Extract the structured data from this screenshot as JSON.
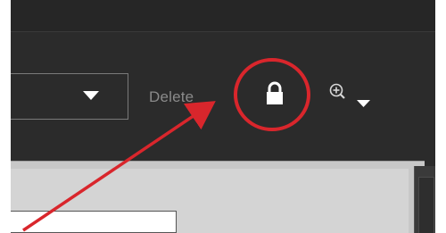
{
  "toolbar": {
    "delete_label": "Delete",
    "dropdown_value": ""
  },
  "icons": {
    "dropdown_arrow": "chevron-down-icon",
    "lock": "lock-icon",
    "zoom": "zoom-in-icon"
  },
  "annotation": {
    "circle_color": "#d9262c",
    "arrow_color": "#d9262c"
  },
  "colors": {
    "toolbar_bg": "#2b2b2b",
    "panel_bg": "#c8c8c8",
    "delete_text": "#8a8a8a"
  }
}
